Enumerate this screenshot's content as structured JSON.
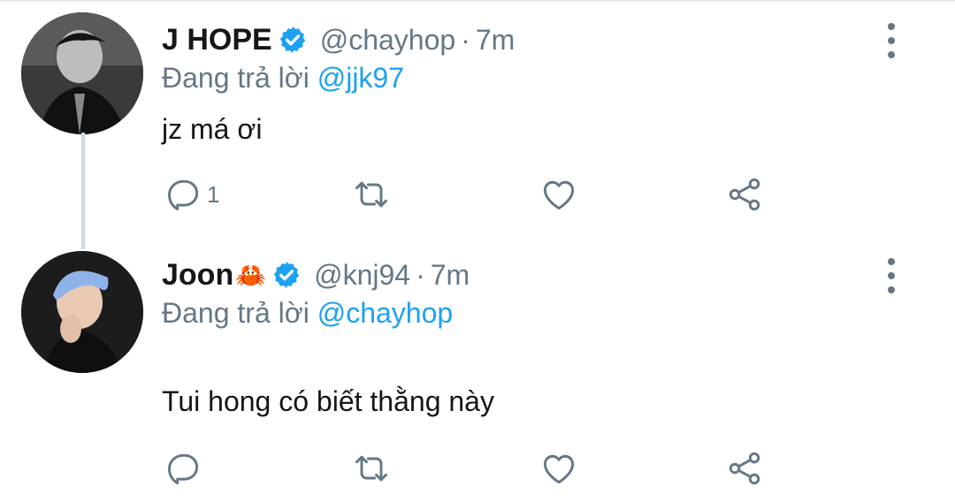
{
  "tweets": [
    {
      "name": "J HOPE",
      "handle": "@chayhop",
      "separator": "·",
      "time": "7m",
      "replying_prefix": "Đang trả lời",
      "replying_to": "@jjk97",
      "text": "jz má ơi",
      "reply_count": "1",
      "avatar_icon": "avatar-photo-grayscale"
    },
    {
      "name": "Joon",
      "name_emoji": "🦀",
      "handle": "@knj94",
      "separator": "·",
      "time": "7m",
      "replying_prefix": "Đang trả lời",
      "replying_to": "@chayhop",
      "text": "Tui hong có biết thằng này",
      "reply_count": "",
      "avatar_icon": "avatar-photo-blue-hair"
    }
  ],
  "colors": {
    "accent": "#1da1f2",
    "secondary_text": "#657786",
    "primary_text": "#14171a"
  },
  "icons": [
    "verified-badge-icon",
    "more-options-icon",
    "reply-icon",
    "retweet-icon",
    "like-icon",
    "share-icon"
  ]
}
